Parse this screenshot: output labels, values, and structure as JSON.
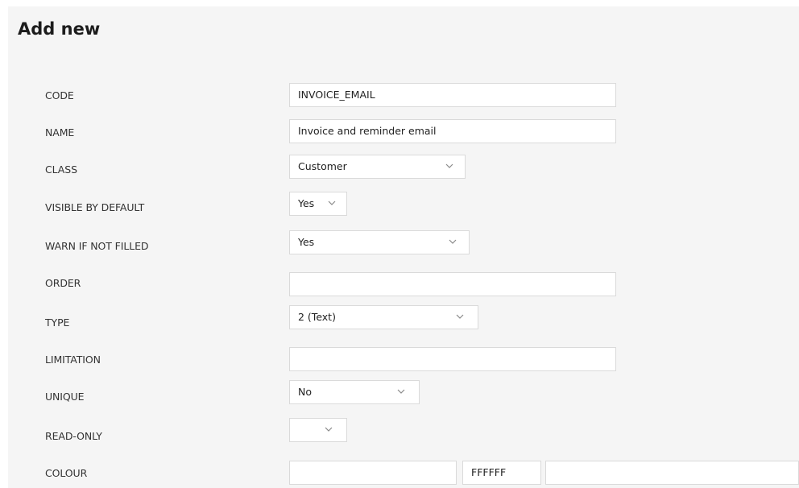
{
  "title": "Add new",
  "fields": [
    {
      "label": "CODE",
      "value": "INVOICE_EMAIL"
    },
    {
      "label": "NAME",
      "value": "Invoice and reminder email"
    },
    {
      "label": "CLASS",
      "value": "Customer"
    },
    {
      "label": "VISIBLE BY DEFAULT",
      "value": "Yes"
    },
    {
      "label": "WARN IF NOT FILLED",
      "value": "Yes"
    },
    {
      "label": "ORDER",
      "value": ""
    },
    {
      "label": "TYPE",
      "value": "2 (Text)"
    },
    {
      "label": "LIMITATION",
      "value": ""
    },
    {
      "label": "UNIQUE",
      "value": "No"
    },
    {
      "label": "READ-ONLY",
      "value": ""
    },
    {
      "label": "COLOUR",
      "value": "",
      "hex": "FFFFFF",
      "extra": ""
    }
  ],
  "colors": {
    "panel_bg": "#f5f5f5",
    "field_border": "#dadada",
    "label_text": "#333333"
  },
  "icons": {
    "dropdown": "chevron-down-icon"
  }
}
